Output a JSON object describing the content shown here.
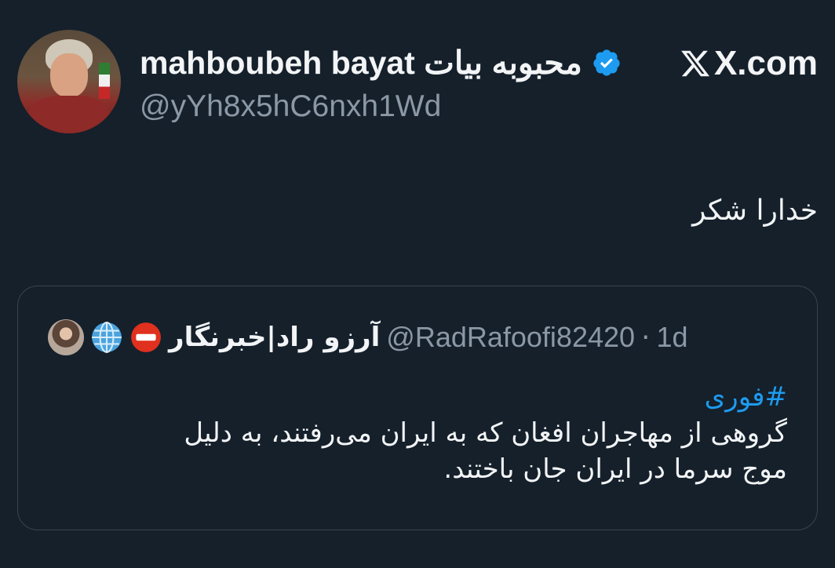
{
  "header": {
    "name": "mahboubeh bayat محبوبه بیات",
    "handle": "@yYh8x5hC6nxh1Wd",
    "brand": "X.com",
    "verified_icon": "verified-badge-icon"
  },
  "tweet": {
    "text": "خدارا شکر"
  },
  "quoted_tweet": {
    "name": "آرزو راد|خبرنگار",
    "handle": "@RadRafoofi82420",
    "separator": "·",
    "time": "1d",
    "emojis": [
      "no-entry-icon",
      "globe-icon"
    ],
    "hashtag": "#فوری",
    "lines": [
      "گروهی از مهاجران افغان که به ایران می‌رفتند، به دلیل",
      "موج سرما در ایران جان باختند."
    ]
  },
  "colors": {
    "background": "#15202b",
    "accent": "#1d9bf0",
    "secondary_text": "#8b98a5",
    "border": "#38444d"
  }
}
